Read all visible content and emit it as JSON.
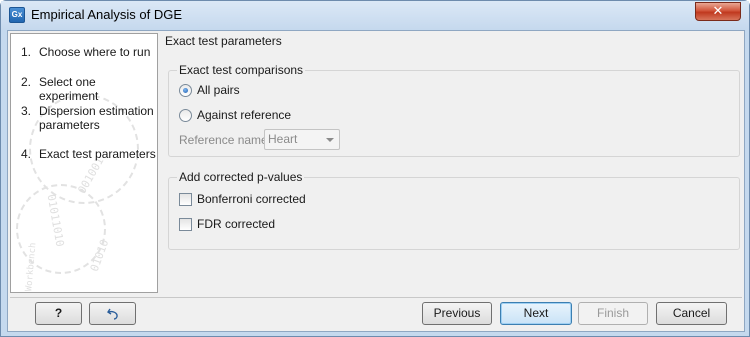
{
  "window": {
    "title": "Empirical Analysis of DGE",
    "close_glyph": "✕",
    "app_icon": "app-icon",
    "app_icon_text": "Gx"
  },
  "steps": [
    {
      "num": "1.",
      "label": "Choose where to run"
    },
    {
      "num": "2.",
      "label": "Select one experiment"
    },
    {
      "num": "3.",
      "label": "Dispersion estimation parameters"
    },
    {
      "num": "4.",
      "label": "Exact test parameters"
    }
  ],
  "watermark": {
    "lines": [
      "001001",
      "01011010",
      "01010",
      "Workbench"
    ]
  },
  "pane": {
    "title": "Exact test parameters"
  },
  "comparisons": {
    "title": "Exact test comparisons",
    "options": [
      {
        "label": "All pairs",
        "selected": true
      },
      {
        "label": "Against reference",
        "selected": false
      }
    ],
    "reference_label": "Reference name",
    "reference_value": "Heart"
  },
  "corrected": {
    "title": "Add corrected p-values",
    "options": [
      {
        "label": "Bonferroni corrected",
        "checked": false
      },
      {
        "label": "FDR corrected",
        "checked": false
      }
    ]
  },
  "buttons": {
    "help": "?",
    "reset_icon": "undo-icon",
    "previous": "Previous",
    "next": "Next",
    "finish": "Finish",
    "cancel": "Cancel"
  }
}
